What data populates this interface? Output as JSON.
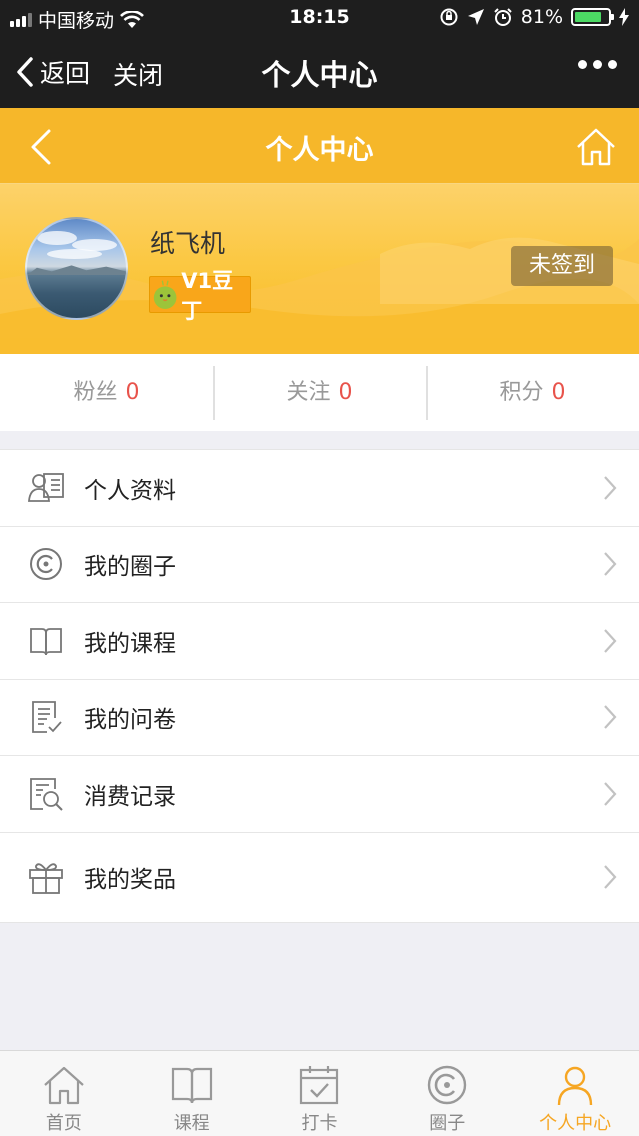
{
  "status_bar": {
    "carrier": "中国移动",
    "time": "18:15",
    "battery_percent": "81%",
    "battery_level": 0.81,
    "icons": [
      "signal-icon",
      "wifi-icon",
      "orientation-lock-icon",
      "location-icon",
      "alarm-icon",
      "battery-icon",
      "charging-icon"
    ]
  },
  "wechat_nav": {
    "back_label": "返回",
    "close_label": "关闭",
    "title": "个人中心",
    "more_icon": "more-dots-icon"
  },
  "page_header": {
    "title": "个人中心",
    "back_icon": "chevron-left-icon",
    "home_icon": "home-icon",
    "color": "#f6b72a"
  },
  "profile": {
    "username": "纸飞机",
    "level": "V1豆丁",
    "checkin_label": "未签到"
  },
  "stats": [
    {
      "label": "粉丝",
      "value": "0"
    },
    {
      "label": "关注",
      "value": "0"
    },
    {
      "label": "积分",
      "value": "0"
    }
  ],
  "menu": [
    {
      "label": "个人资料",
      "icon": "id-card-icon"
    },
    {
      "label": "我的圈子",
      "icon": "circle-icon"
    },
    {
      "label": "我的课程",
      "icon": "book-icon"
    },
    {
      "label": "我的问卷",
      "icon": "checklist-icon"
    },
    {
      "label": "消费记录",
      "icon": "receipt-search-icon"
    },
    {
      "label": "我的奖品",
      "icon": "gift-icon"
    }
  ],
  "tabbar": {
    "active_color": "#f6a623",
    "tabs": [
      {
        "label": "首页",
        "icon": "home-icon"
      },
      {
        "label": "课程",
        "icon": "book-icon"
      },
      {
        "label": "打卡",
        "icon": "calendar-check-icon"
      },
      {
        "label": "圈子",
        "icon": "circle-icon"
      },
      {
        "label": "个人中心",
        "icon": "user-icon",
        "active": true
      }
    ]
  }
}
